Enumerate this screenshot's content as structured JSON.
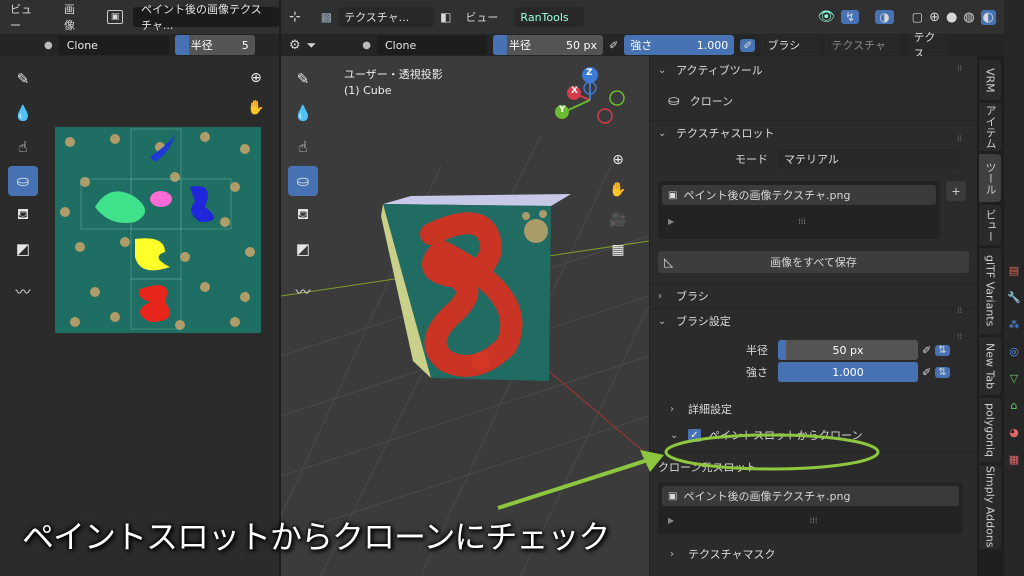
{
  "left_editor": {
    "header": {
      "view_menu": "ビュー",
      "image_menu": "画像",
      "image_name": "ペイント後の画像テクスチャ..."
    },
    "tool_header": {
      "brush_name": "Clone",
      "radius_label": "半径",
      "radius_value": "5"
    }
  },
  "viewport": {
    "header": {
      "mode": "テクスチャ...",
      "view_menu": "ビュー",
      "addon_menu": "RanTools"
    },
    "tool_header": {
      "brush_name": "Clone",
      "radius_label": "半径",
      "radius_value": "50 px",
      "strength_label": "強さ",
      "strength_value": "1.000",
      "brush_menu": "ブラシ",
      "texture_menu": "テクスチャ",
      "texture_menu2": "テクス"
    },
    "overlay_text": {
      "projection": "ユーザー・透視投影",
      "object": "(1) Cube"
    },
    "gizmo": {
      "z": "Z",
      "x": "X",
      "y": "Y"
    }
  },
  "sidebar": {
    "active_tool": {
      "title": "アクティブツール",
      "tool_name": "クローン"
    },
    "texture_slots": {
      "title": "テクスチャスロット",
      "mode_label": "モード",
      "mode_value": "マテリアル",
      "slot_item": "ペイント後の画像テクスチャ.png",
      "save_all": "画像をすべて保存"
    },
    "brush": {
      "title": "ブラシ"
    },
    "brush_settings": {
      "title": "ブラシ設定",
      "radius_label": "半径",
      "radius_value": "50 px",
      "strength_label": "強さ",
      "strength_value": "1.000",
      "advanced": "詳細設定",
      "clone_from_slot": "ペイントスロットからクローン",
      "clone_from_slot_checked": true,
      "clone_source_label": "クローン元スロット",
      "clone_source_item": "ペイント後の画像テクスチャ.png",
      "texture_mask": "テクスチャマスク"
    },
    "tabs": [
      "VRM",
      "アイテム",
      "ツール",
      "ビュー",
      "glTF Variants",
      "New Tab",
      "polygoniq",
      "Simply Addons"
    ],
    "active_tab_index": 2
  },
  "caption": "ペイントスロットからクローンにチェック",
  "colors": {
    "accent": "#4772b3",
    "highlight": "#8dc63f",
    "panel": "#2b2b2b"
  }
}
